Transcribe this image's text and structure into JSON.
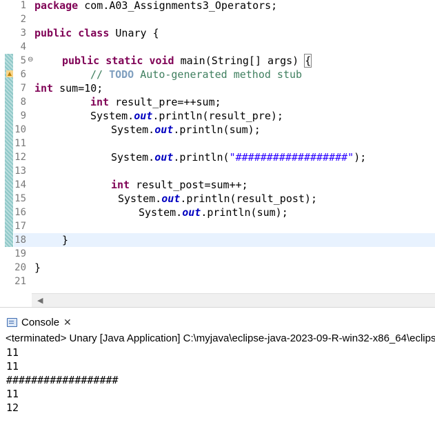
{
  "editor": {
    "line_numbers": [
      "1",
      "2",
      "3",
      "4",
      "5",
      "6",
      "7",
      "8",
      "9",
      "10",
      "11",
      "12",
      "13",
      "14",
      "15",
      "16",
      "17",
      "18",
      "19",
      "20",
      "21"
    ],
    "code": {
      "l1": {
        "kw": "package",
        "rest": " com.A03_Assignments3_Operators;"
      },
      "l3": {
        "kw1": "public",
        "kw2": "class",
        "rest": " Unary {"
      },
      "l5": {
        "kw1": "public",
        "kw2": "static",
        "kw3": "void",
        "rest": " main(String[] args) ",
        "brace": "{"
      },
      "l6": {
        "c1": "// ",
        "todo": "TODO",
        "c2": " Auto-generated method stub"
      },
      "l7": {
        "kw": "int",
        "rest": " sum=10;"
      },
      "l8": {
        "kw": "int",
        "rest": " result_pre=++sum;"
      },
      "l9": {
        "a": "System.",
        "out": "out",
        "b": ".println(result_pre);"
      },
      "l10": {
        "a": "System.",
        "out": "out",
        "b": ".println(sum);"
      },
      "l12": {
        "a": "System.",
        "out": "out",
        "b": ".println(",
        "str": "\"##################\"",
        "c": ");"
      },
      "l14": {
        "kw": "int",
        "rest": " result_post=sum++;"
      },
      "l15": {
        "a": "System.",
        "out": "out",
        "b": ".println(result_post);"
      },
      "l16": {
        "a": "System.",
        "out": "out",
        "b": ".println(sum);"
      },
      "l18": "}",
      "l20": "}"
    }
  },
  "console": {
    "tab_label": "Console",
    "close_symbol": "✕",
    "terminated_text": "<terminated> Unary [Java Application] C:\\myjava\\eclipse-java-2023-09-R-win32-x86_64\\eclipse",
    "output_lines": [
      "11",
      "11",
      "##################",
      "11",
      "12"
    ]
  },
  "icons": [
    "fold-collapse-icon",
    "warning-marker-icon",
    "scroll-left-arrow-icon",
    "console-icon",
    "close-icon"
  ]
}
